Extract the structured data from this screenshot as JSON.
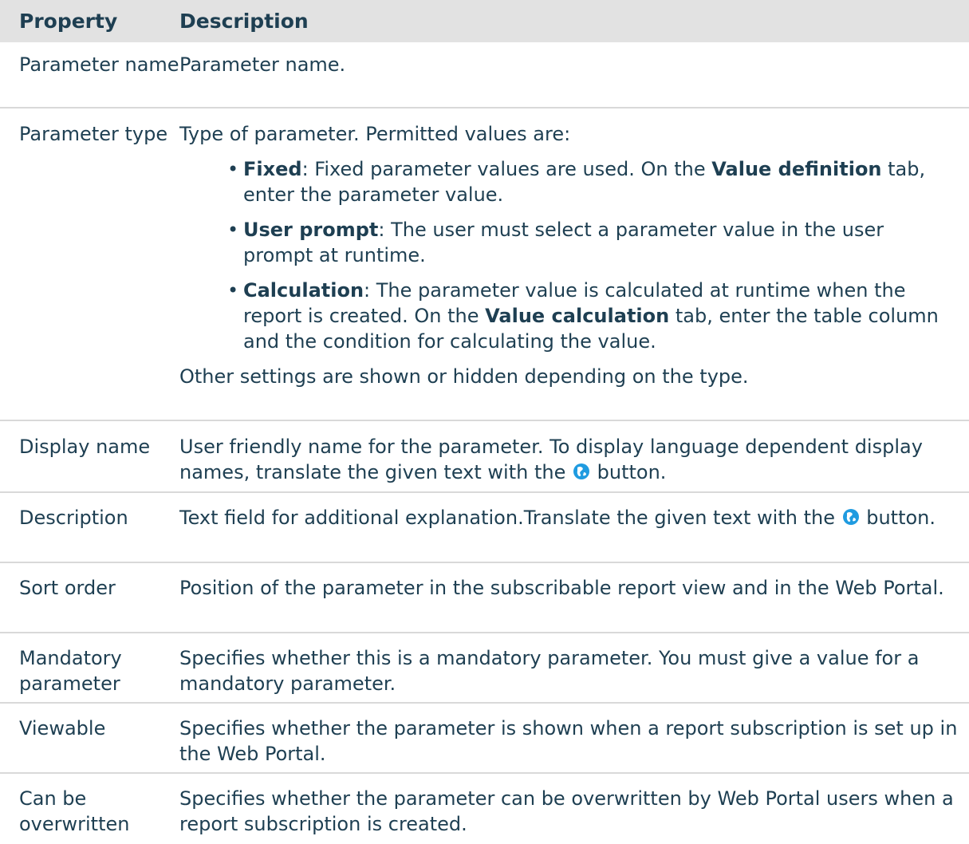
{
  "header": {
    "property": "Property",
    "description": "Description"
  },
  "rows": {
    "parameter_name": {
      "property": "Parameter name",
      "description": "Parameter name."
    },
    "parameter_type": {
      "property": "Parameter type",
      "intro": "Type of parameter. Permitted values are:",
      "fixed": {
        "term": "Fixed",
        "text_before": ": Fixed parameter values are used. On the ",
        "tab": "Value definition",
        "text_after": " tab, enter the parameter value."
      },
      "user_prompt": {
        "term": "User prompt",
        "text": ": The user must select a parameter value in the user prompt at runtime."
      },
      "calculation": {
        "term": "Calculation",
        "text_before": ": The parameter value is calculated at runtime when the report is created. On the ",
        "tab": "Value calculation",
        "text_after": " tab, enter the table column and the condition for calculating the value."
      },
      "outro": "Other settings are shown or hidden depending on the type."
    },
    "display_name": {
      "property": "Display name",
      "text_before": "User friendly name for the parameter. To display language dependent display names, translate the given text with the ",
      "text_after": " button."
    },
    "description": {
      "property": "Description",
      "text_before": "Text field for additional explanation.Translate the given text with the ",
      "text_after": " button."
    },
    "sort_order": {
      "property": "Sort order",
      "description": "Position of the parameter in the subscribable report view and in the Web Portal."
    },
    "mandatory": {
      "property": "Mandatory parameter",
      "description": "Specifies whether this is a mandatory parameter. You must give a value for a mandatory parameter."
    },
    "viewable": {
      "property": "Viewable",
      "description": "Specifies whether the parameter is shown when a report subscription is set up in the Web Portal."
    },
    "overwritable": {
      "property": "Can be overwritten",
      "description": "Specifies whether the parameter can be overwritten by Web Portal users when a report subscription is created."
    }
  },
  "icons": {
    "translate": "globe-icon"
  },
  "colors": {
    "text": "#1e3f52",
    "header_bg": "#e2e2e2",
    "divider": "#d9d9d9",
    "icon_blue": "#1f9be0"
  }
}
